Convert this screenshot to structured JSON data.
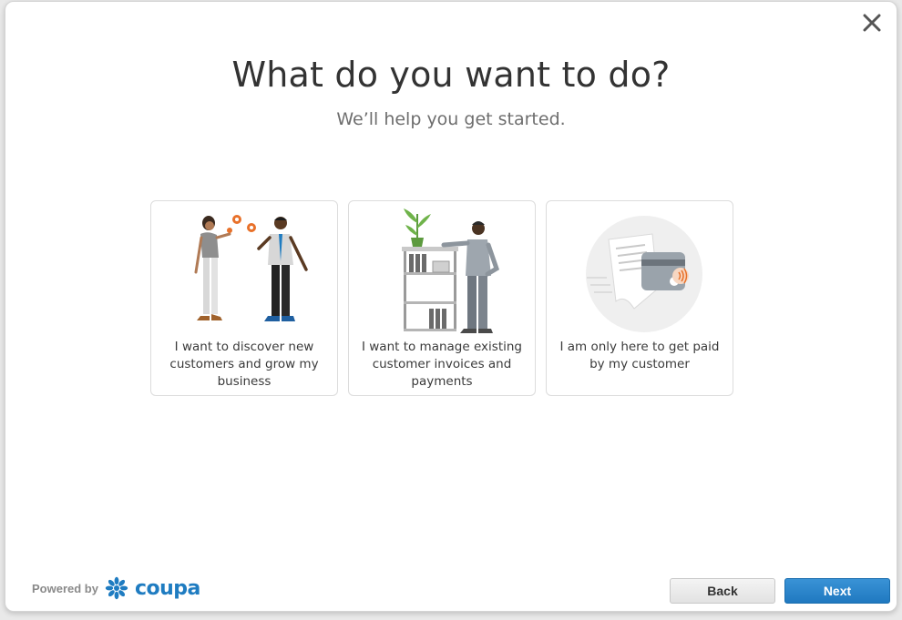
{
  "dialog": {
    "title": "What do you want to do?",
    "subtitle": "We’ll help you get started."
  },
  "options": [
    {
      "label": "I want to discover new customers and grow my business",
      "icon": "business-people-gears-illustration"
    },
    {
      "label": "I want to manage existing customer invoices and payments",
      "icon": "person-shelf-plant-illustration"
    },
    {
      "label": "I am only here to get paid by my customer",
      "icon": "receipt-credit-card-illustration"
    }
  ],
  "footer": {
    "powered_by": "Powered by",
    "brand": "coupa",
    "back_label": "Back",
    "next_label": "Next"
  },
  "colors": {
    "accent": "#2079c0",
    "title": "#333333",
    "subtitle": "#6e6e6e",
    "illustration_orange": "#e8712a"
  }
}
